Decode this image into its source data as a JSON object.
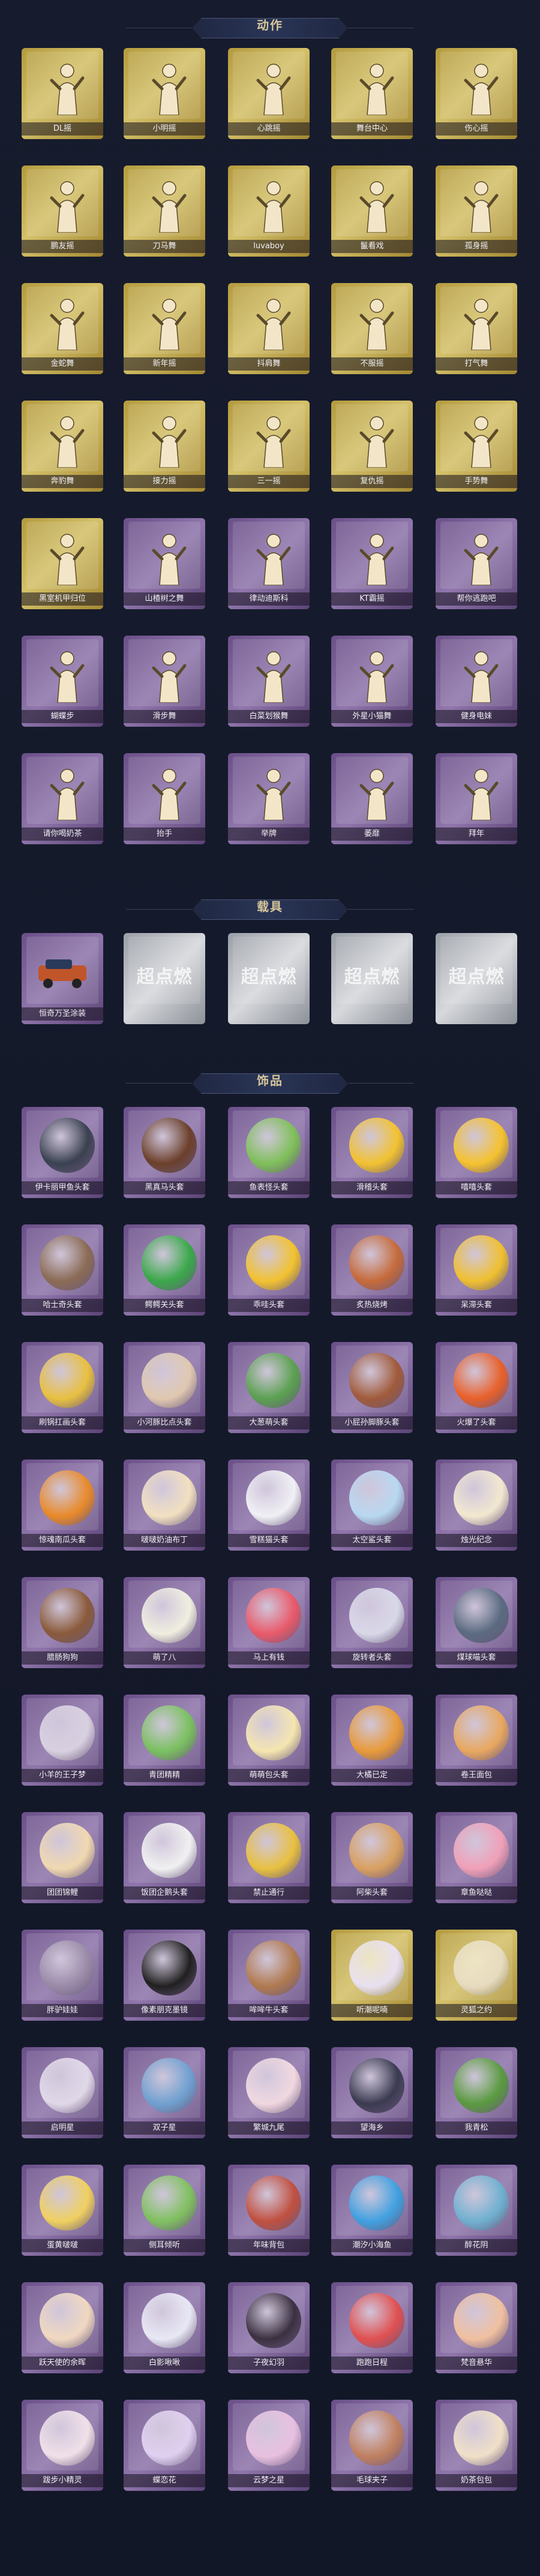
{
  "sections": {
    "actions_title": "动作",
    "vehicles_title": "载具",
    "accessories_title": "饰品"
  },
  "actions": [
    {
      "label": "DL摇",
      "variant": "gold"
    },
    {
      "label": "小明摇",
      "variant": "gold"
    },
    {
      "label": "心跳摇",
      "variant": "gold"
    },
    {
      "label": "舞台中心",
      "variant": "gold"
    },
    {
      "label": "伤心摇",
      "variant": "gold"
    },
    {
      "label": "鹏友摇",
      "variant": "gold"
    },
    {
      "label": "刀马舞",
      "variant": "gold"
    },
    {
      "label": "luvaboy",
      "variant": "gold"
    },
    {
      "label": "鬣看戏",
      "variant": "gold"
    },
    {
      "label": "孤身摇",
      "variant": "gold"
    },
    {
      "label": "金蛇舞",
      "variant": "gold"
    },
    {
      "label": "新年摇",
      "variant": "gold"
    },
    {
      "label": "抖肩舞",
      "variant": "gold"
    },
    {
      "label": "不服摇",
      "variant": "gold"
    },
    {
      "label": "打气舞",
      "variant": "gold"
    },
    {
      "label": "奔豹舞",
      "variant": "gold"
    },
    {
      "label": "接力摇",
      "variant": "gold"
    },
    {
      "label": "三一摇",
      "variant": "gold"
    },
    {
      "label": "复仇摇",
      "variant": "gold"
    },
    {
      "label": "手势舞",
      "variant": "gold"
    },
    {
      "label": "黑室机甲归位",
      "variant": "gold"
    },
    {
      "label": "山楂树之舞",
      "variant": "purple"
    },
    {
      "label": "律动迪斯科",
      "variant": "purple"
    },
    {
      "label": "KT霸摇",
      "variant": "purple"
    },
    {
      "label": "帮你逃跑吧",
      "variant": "purple"
    },
    {
      "label": "蝴蝶步",
      "variant": "purple"
    },
    {
      "label": "滑步舞",
      "variant": "purple"
    },
    {
      "label": "白菜划猴舞",
      "variant": "purple"
    },
    {
      "label": "外星小猫舞",
      "variant": "purple"
    },
    {
      "label": "健身电妹",
      "variant": "purple"
    },
    {
      "label": "请你喝奶茶",
      "variant": "purple"
    },
    {
      "label": "抬手",
      "variant": "purple"
    },
    {
      "label": "举牌",
      "variant": "purple"
    },
    {
      "label": "萎靡",
      "variant": "purple"
    },
    {
      "label": "拜年",
      "variant": "purple"
    }
  ],
  "vehicles": [
    {
      "label": "恒奇万圣涂装",
      "variant": "purple",
      "brand": ""
    },
    {
      "label": "",
      "variant": "silver",
      "brand": "超点燃"
    },
    {
      "label": "",
      "variant": "silver",
      "brand": "超点燃"
    },
    {
      "label": "",
      "variant": "silver",
      "brand": "超点燃"
    },
    {
      "label": "",
      "variant": "silver",
      "brand": "超点燃"
    }
  ],
  "accessories": [
    {
      "label": "伊卡丽甲鱼头套",
      "variant": "purple",
      "color": "#3a4150"
    },
    {
      "label": "黑真马头套",
      "variant": "purple",
      "color": "#6b3f2a"
    },
    {
      "label": "鱼表怪头套",
      "variant": "purple",
      "color": "#7fbf5a"
    },
    {
      "label": "滑稽头套",
      "variant": "purple",
      "color": "#f2c230"
    },
    {
      "label": "嘻嘻头套",
      "variant": "purple",
      "color": "#f5c22e"
    },
    {
      "label": "哈士奇头套",
      "variant": "purple",
      "color": "#8a6b55"
    },
    {
      "label": "鳄鳄关头套",
      "variant": "purple",
      "color": "#3aa84a"
    },
    {
      "label": "乖哇头套",
      "variant": "purple",
      "color": "#f2c230"
    },
    {
      "label": "炙热烧烤",
      "variant": "purple",
      "color": "#c56a3a"
    },
    {
      "label": "呆滞头套",
      "variant": "purple",
      "color": "#f0c030"
    },
    {
      "label": "刷锅扛画头套",
      "variant": "purple",
      "color": "#e8c040"
    },
    {
      "label": "小河豚比点头套",
      "variant": "purple",
      "color": "#e0c8b0"
    },
    {
      "label": "大葱萌头套",
      "variant": "purple",
      "color": "#5aa050"
    },
    {
      "label": "小屁孙脚豚头套",
      "variant": "purple",
      "color": "#a05a3a"
    },
    {
      "label": "火爆了头套",
      "variant": "purple",
      "color": "#e8602a"
    },
    {
      "label": "惊魂南瓜头套",
      "variant": "purple",
      "color": "#e88a2a"
    },
    {
      "label": "啵啵奶油布丁",
      "variant": "purple",
      "color": "#f2e0c0"
    },
    {
      "label": "雪糕猫头套",
      "variant": "purple",
      "color": "#f0f0f5"
    },
    {
      "label": "太空鲨头套",
      "variant": "purple",
      "color": "#b8d8f0"
    },
    {
      "label": "烛光纪念",
      "variant": "purple",
      "color": "#f2e8d0"
    },
    {
      "label": "腊肠狗狗",
      "variant": "purple",
      "color": "#8a5a3a"
    },
    {
      "label": "萌了八",
      "variant": "purple",
      "color": "#f0eee0"
    },
    {
      "label": "马上有钱",
      "variant": "purple",
      "color": "#e85a6a"
    },
    {
      "label": "旋转者头套",
      "variant": "purple",
      "color": "#d8d8e8"
    },
    {
      "label": "煤球喵头套",
      "variant": "purple",
      "color": "#5a6a80"
    },
    {
      "label": "小羊的王子梦",
      "variant": "purple",
      "color": "#d8d0e0"
    },
    {
      "label": "青团精精",
      "variant": "purple",
      "color": "#7ac060"
    },
    {
      "label": "萌萌包头套",
      "variant": "purple",
      "color": "#f5e6b0"
    },
    {
      "label": "大橘已定",
      "variant": "purple",
      "color": "#e89a3a"
    },
    {
      "label": "卷王面包",
      "variant": "purple",
      "color": "#e8a860"
    },
    {
      "label": "团团锦鲤",
      "variant": "purple",
      "color": "#f0d8b0"
    },
    {
      "label": "饭团企鹅头套",
      "variant": "purple",
      "color": "#f0f0f0"
    },
    {
      "label": "禁止通行",
      "variant": "purple",
      "color": "#e8c040"
    },
    {
      "label": "阿柴头套",
      "variant": "purple",
      "color": "#d8a060"
    },
    {
      "label": "章鱼哒哒",
      "variant": "purple",
      "color": "#f0a0b8"
    },
    {
      "label": "胖驴娃娃",
      "variant": "purple",
      "color": "#9a8aa8"
    },
    {
      "label": "像素朋克墨镜",
      "variant": "purple",
      "color": "#202020"
    },
    {
      "label": "哞哞牛头套",
      "variant": "purple",
      "color": "#b07a50"
    },
    {
      "label": "听潮呢喃",
      "variant": "gold",
      "color": "#e8e0f0"
    },
    {
      "label": "灵狐之约",
      "variant": "gold",
      "color": "#e8dcc0"
    },
    {
      "label": "启明星",
      "variant": "purple",
      "color": "#e0d8e8"
    },
    {
      "label": "双子星",
      "variant": "purple",
      "color": "#70a0d0"
    },
    {
      "label": "繁城九尾",
      "variant": "purple",
      "color": "#f0d8e0"
    },
    {
      "label": "望海乡",
      "variant": "purple",
      "color": "#3a3a50"
    },
    {
      "label": "我青松",
      "variant": "purple",
      "color": "#5a9a40"
    },
    {
      "label": "蛋黄啵啵",
      "variant": "purple",
      "color": "#f0d060"
    },
    {
      "label": "侧耳倾听",
      "variant": "purple",
      "color": "#80c060"
    },
    {
      "label": "年味背包",
      "variant": "purple",
      "color": "#c05040"
    },
    {
      "label": "潮汐小海鱼",
      "variant": "purple",
      "color": "#40a0e0"
    },
    {
      "label": "醉花阴",
      "variant": "purple",
      "color": "#70b0d0"
    },
    {
      "label": "跃天使的余晖",
      "variant": "purple",
      "color": "#f0d8c0"
    },
    {
      "label": "白影啾啾",
      "variant": "purple",
      "color": "#e8e8f5"
    },
    {
      "label": "子夜幻羽",
      "variant": "purple",
      "color": "#3a3040"
    },
    {
      "label": "跑跑日程",
      "variant": "purple",
      "color": "#e05050"
    },
    {
      "label": "梵音悬华",
      "variant": "purple",
      "color": "#f0c0a0"
    },
    {
      "label": "跋步小精灵",
      "variant": "purple",
      "color": "#f0e0e8"
    },
    {
      "label": "蝶恋花",
      "variant": "purple",
      "color": "#e0d0f0"
    },
    {
      "label": "云梦之星",
      "variant": "purple",
      "color": "#e8c0e0"
    },
    {
      "label": "毛球夹子",
      "variant": "purple",
      "color": "#c08060"
    },
    {
      "label": "奶茶包包",
      "variant": "purple",
      "color": "#f0e0c8"
    }
  ]
}
